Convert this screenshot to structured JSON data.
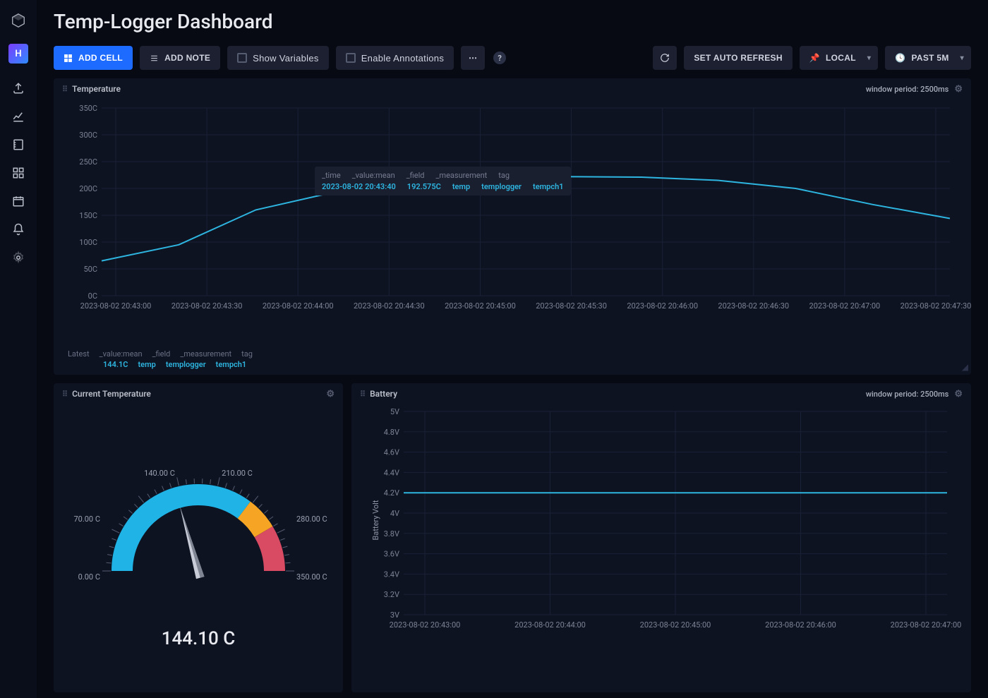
{
  "sidebar": {
    "avatar_letter": "H"
  },
  "title": "Temp-Logger Dashboard",
  "toolbar": {
    "add_cell": "ADD CELL",
    "add_note": "ADD NOTE",
    "show_vars": "Show Variables",
    "enable_annot": "Enable Annotations",
    "set_refresh": "SET AUTO REFRESH",
    "tz": "Local",
    "range": "Past 5m"
  },
  "temp_cell": {
    "title": "Temperature",
    "window": "window period: 2500ms",
    "y_ticks": [
      "0C",
      "50C",
      "100C",
      "150C",
      "200C",
      "250C",
      "300C",
      "350C"
    ],
    "x_ticks": [
      "2023-08-02 20:43:00",
      "2023-08-02 20:43:30",
      "2023-08-02 20:44:00",
      "2023-08-02 20:44:30",
      "2023-08-02 20:45:00",
      "2023-08-02 20:45:30",
      "2023-08-02 20:46:00",
      "2023-08-02 20:46:30",
      "2023-08-02 20:47:00",
      "2023-08-02 20:47:30"
    ],
    "tooltip": {
      "hd": [
        "_time",
        "_value:mean",
        "_field",
        "_measurement",
        "tag"
      ],
      "row": [
        "2023-08-02 20:43:40",
        "192.575C",
        "temp",
        "templogger",
        "tempch1"
      ]
    },
    "legend_hd": [
      "Latest",
      "_value:mean",
      "_field",
      "_measurement",
      "tag"
    ],
    "legend_row": [
      "144.1C",
      "temp",
      "templogger",
      "tempch1"
    ]
  },
  "gauge_cell": {
    "title": "Current Temperature",
    "labels": {
      "l0": "0.00 C",
      "l70": "70.00 C",
      "l140": "140.00 C",
      "l210": "210.00 C",
      "l280": "280.00 C",
      "l350": "350.00 C"
    },
    "value": "144.10 C"
  },
  "batt_cell": {
    "title": "Battery",
    "window": "window period: 2500ms",
    "y_label": "Battery Volt",
    "y_ticks": [
      "3V",
      "3.2V",
      "3.4V",
      "3.6V",
      "3.8V",
      "4V",
      "4.2V",
      "4.4V",
      "4.6V",
      "4.8V",
      "5V"
    ],
    "x_ticks": [
      "2023-08-02 20:43:00",
      "2023-08-02 20:44:00",
      "2023-08-02 20:45:00",
      "2023-08-02 20:46:00",
      "2023-08-02 20:47:00"
    ]
  },
  "chart_data": [
    {
      "type": "line",
      "title": "Temperature",
      "ylabel": "",
      "ylim": [
        0,
        350
      ],
      "yunit": "C",
      "x": [
        "2023-08-02 20:42:45",
        "2023-08-02 20:43:00",
        "2023-08-02 20:43:20",
        "2023-08-02 20:43:40",
        "2023-08-02 20:44:20",
        "2023-08-02 20:45:00",
        "2023-08-02 20:45:30",
        "2023-08-02 20:46:00",
        "2023-08-02 20:46:30",
        "2023-08-02 20:47:00",
        "2023-08-02 20:47:30",
        "2023-08-02 20:47:45"
      ],
      "series": [
        {
          "name": "tempch1",
          "values": [
            65,
            95,
            160,
            192.575,
            210,
            219,
            222,
            221,
            215,
            200,
            170,
            144.1
          ]
        }
      ]
    },
    {
      "type": "gauge",
      "title": "Current Temperature",
      "min": 0,
      "max": 350,
      "value": 144.1,
      "unit": "C",
      "thresholds": [
        {
          "from": 0,
          "to": 210,
          "color": "#1fb3e6"
        },
        {
          "from": 210,
          "to": 245,
          "color": "#f5a523"
        },
        {
          "from": 245,
          "to": 350,
          "color": "#d94a63"
        }
      ]
    },
    {
      "type": "line",
      "title": "Battery",
      "ylabel": "Battery Volt",
      "ylim": [
        3,
        5
      ],
      "yunit": "V",
      "x": [
        "2023-08-02 20:43:00",
        "2023-08-02 20:44:00",
        "2023-08-02 20:45:00",
        "2023-08-02 20:46:00",
        "2023-08-02 20:47:00",
        "2023-08-02 20:47:45"
      ],
      "series": [
        {
          "name": "battery",
          "values": [
            4.2,
            4.2,
            4.2,
            4.2,
            4.2,
            4.2
          ]
        }
      ]
    }
  ]
}
